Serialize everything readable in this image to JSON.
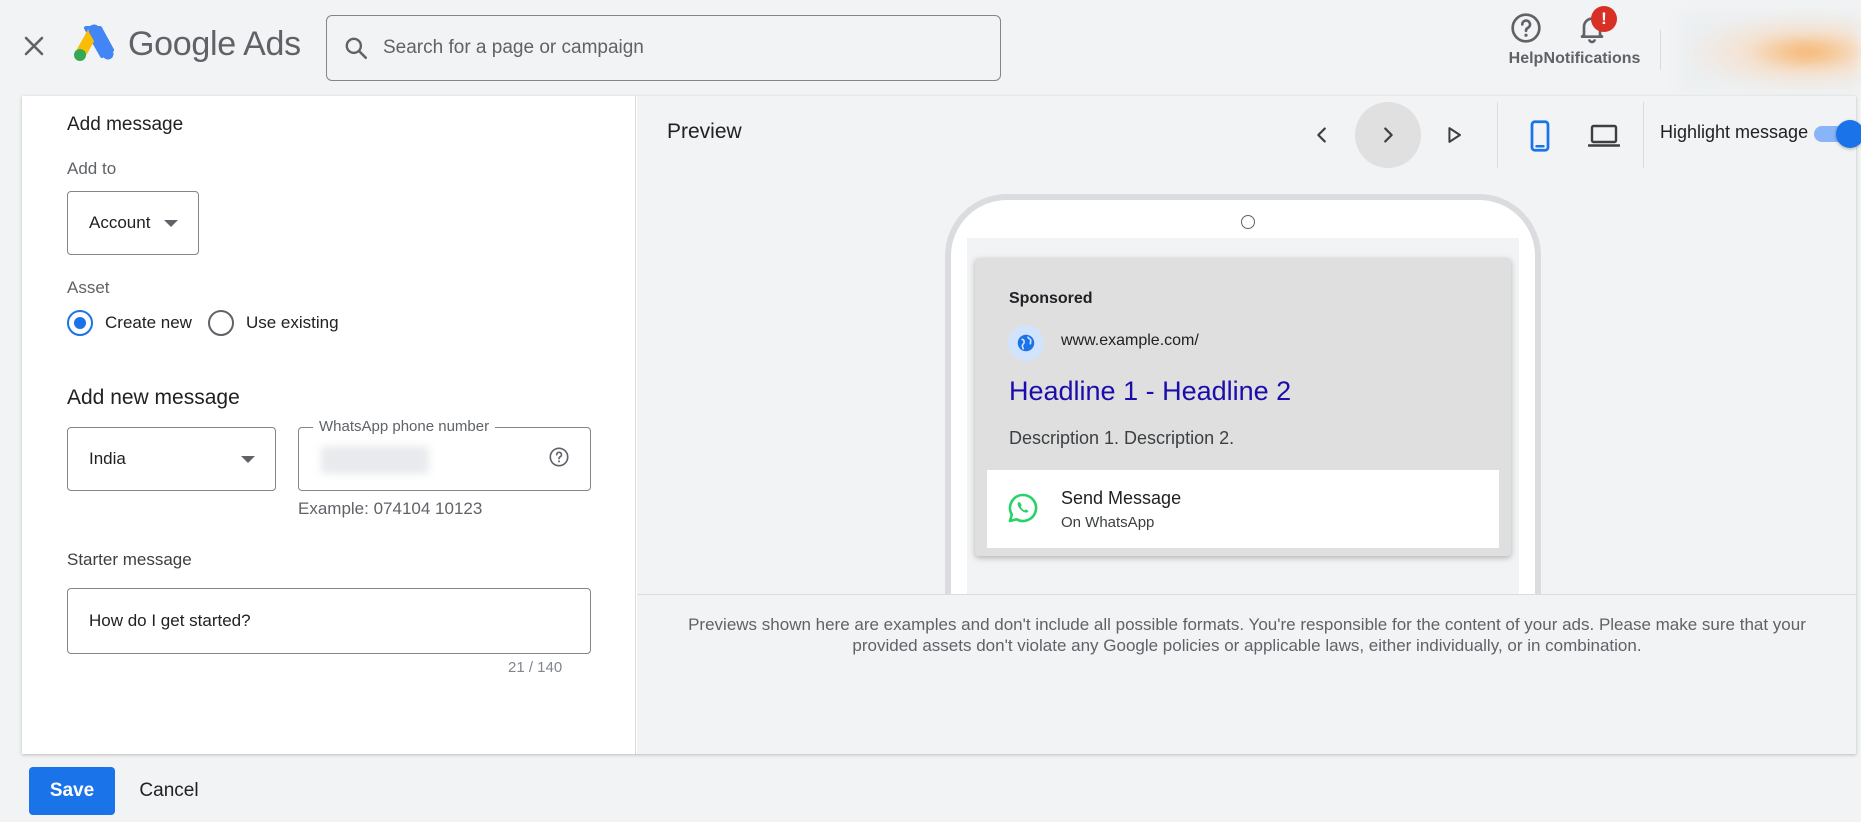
{
  "app": {
    "logo_google": "Google",
    "logo_ads": "Ads"
  },
  "header": {
    "search_placeholder": "Search for a page or campaign",
    "help_label": "Help",
    "notifications_label": "Notifications",
    "notification_badge": "!"
  },
  "form": {
    "section_title": "Add message",
    "add_to_label": "Add to",
    "add_to_value": "Account",
    "asset_label": "Asset",
    "asset_options": [
      "Create new",
      "Use existing"
    ],
    "asset_selected": "Create new",
    "new_message_title": "Add new message",
    "country_value": "India",
    "phone_label": "WhatsApp phone number",
    "phone_example": "Example: 074104 10123",
    "starter_label": "Starter message",
    "starter_value": "How do I get started?",
    "starter_counter": "21 / 140"
  },
  "preview": {
    "title": "Preview",
    "highlight_label": "Highlight message",
    "highlight_on": true,
    "device_selected": "mobile",
    "ad": {
      "sponsored": "Sponsored",
      "url": "www.example.com/",
      "headline": "Headline 1 - Headline 2",
      "description": "Description 1. Description 2.",
      "message_title": "Send Message",
      "message_sub": "On WhatsApp"
    },
    "disclaimer": "Previews shown here are examples and don't include all possible formats. You're responsible for the content of your ads. Please make sure that your provided assets don't violate any Google policies or applicable laws, either individually, or in combination."
  },
  "footer": {
    "save_label": "Save",
    "cancel_label": "Cancel"
  },
  "colors": {
    "accent": "#1a73e8",
    "headline": "#1a0dab",
    "whatsapp": "#25d366",
    "badge": "#d93025"
  }
}
